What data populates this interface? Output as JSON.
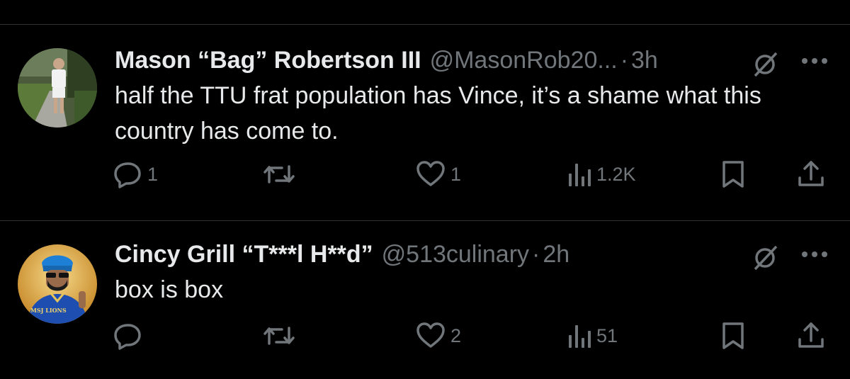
{
  "tweets": [
    {
      "display_name": "Mason “Bag” Robertson III",
      "handle": "@MasonRob20...",
      "dot": "·",
      "time": "3h",
      "text": "half the TTU frat population has Vince, it’s a shame what this country has come to.",
      "replies": "1",
      "retweets": "",
      "likes": "1",
      "views": "1.2K"
    },
    {
      "display_name": "Cincy Grill “T***l H**d”",
      "handle": "@513culinary",
      "dot": "·",
      "time": "2h",
      "text": "box is box",
      "replies": "",
      "retweets": "",
      "likes": "2",
      "views": "51",
      "avatar_text": "MSJ LIONS"
    }
  ],
  "colors": {
    "background": "#000000",
    "primary_text": "#e7e9ea",
    "secondary_text": "#71767b",
    "divider": "#2f3336"
  },
  "icons": [
    "reply-icon",
    "retweet-icon",
    "like-icon",
    "views-icon",
    "bookmark-icon",
    "share-icon",
    "grok-icon",
    "more-icon"
  ]
}
